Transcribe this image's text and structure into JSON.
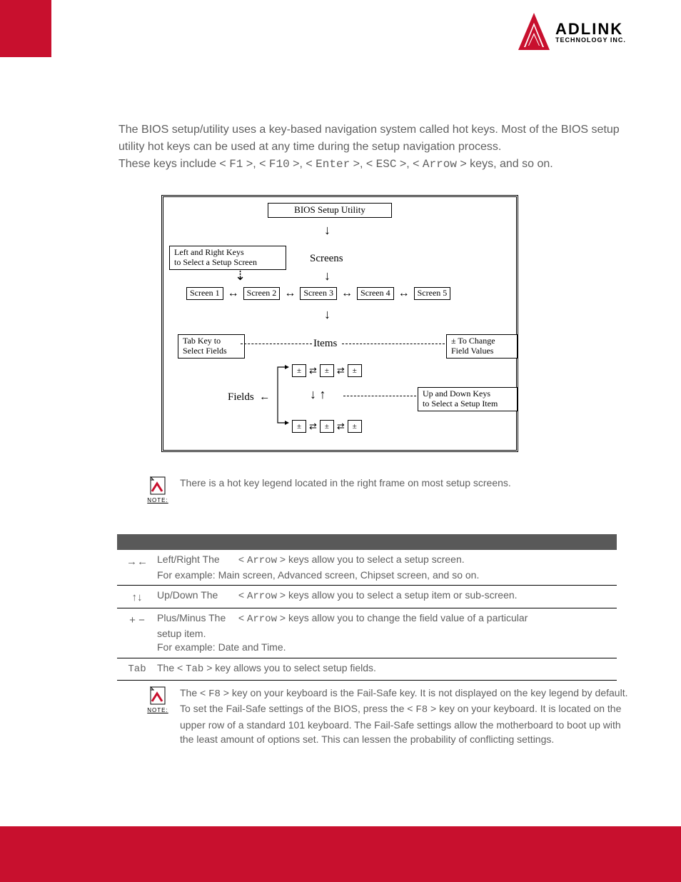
{
  "logo": {
    "name_line1": "ADLINK",
    "name_line2": "TECHNOLOGY INC."
  },
  "intro": {
    "p1a": "The BIOS setup/utility uses a key-based navigation system called hot keys. Most of the BIOS setup utility hot keys can be used at any time during the setup navigation process.",
    "p2a": "These keys include < ",
    "k1": "F1",
    "sep1": " >, < ",
    "k2": "F10",
    "sep2": " >, < ",
    "k3": "Enter",
    "sep3": " >, < ",
    "k4": "ESC",
    "sep4": " >, < ",
    "k5": "Arrow",
    "p2b": " > keys, and so on."
  },
  "diagram": {
    "title": "BIOS Setup Utility",
    "lrkeys_l1": "Left and Right Keys",
    "lrkeys_l2": "to Select a Setup Screen",
    "screens_label": "Screens",
    "s1": "Screen 1",
    "s2": "Screen 2",
    "s3": "Screen 3",
    "s4": "Screen 4",
    "s5": "Screen 5",
    "tabkey_l1": "Tab Key to",
    "tabkey_l2": "Select Fields",
    "items_label": "Items",
    "pm_l1": "± To Change",
    "pm_l2": "Field Values",
    "fields_label": "Fields",
    "udkeys_l1": "Up and Down Keys",
    "udkeys_l2": "to Select a Setup Item",
    "pm_cell": "±"
  },
  "note1": {
    "label": "NOTE:",
    "text": "There is a hot key legend located in the right frame on most setup screens."
  },
  "table": {
    "r1_sym": "→←",
    "r1_lbl": "Left/Right The ",
    "r1_mid_pre": "< ",
    "r1_key": "Arrow",
    "r1_mid_post": " > keys allow you to select a setup screen.",
    "r1_ex": "For example: Main screen, Advanced screen, Chipset screen, and so on.",
    "r2_sym": "↑↓",
    "r2_lbl": "Up/Down The ",
    "r2_mid_pre": "< ",
    "r2_key": "Arrow",
    "r2_mid_post": " > keys allow you to select a setup item or sub-screen.",
    "r3_sym": "+ −",
    "r3_lbl": "Plus/Minus The ",
    "r3_mid_pre": "< ",
    "r3_key": "Arrow",
    "r3_mid_post": " > keys allow you to change the field value of a particular",
    "r3_l2": "setup item.",
    "r3_ex": "For example: Date and Time.",
    "r4_sym": "Tab",
    "r4_pre": "The < ",
    "r4_key": "Tab",
    "r4_post": " > key allows you to select setup fields."
  },
  "note2": {
    "label": "NOTE:",
    "a": "The < ",
    "k1": "F8",
    "b": " > key on your keyboard is the Fail-Safe key. It is not displayed on the key legend by default. To set the Fail-Safe settings of the BIOS, press the < ",
    "k2": "F8",
    "c": " > key on your keyboard. It is located on the upper row of a standard 101 keyboard. The Fail-Safe settings allow the motherboard to boot up with the least amount of options set. This can lessen the probability of conflicting settings."
  }
}
